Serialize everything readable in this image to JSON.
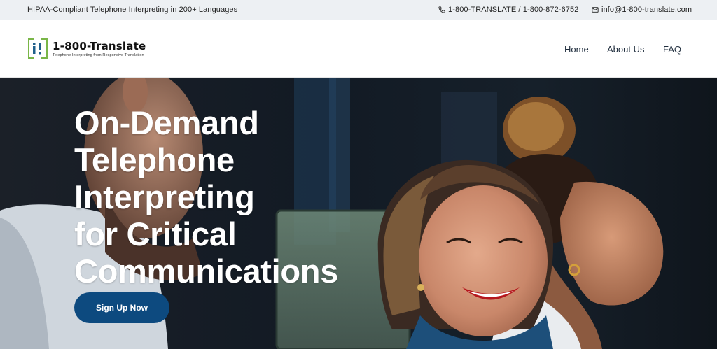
{
  "topbar": {
    "tagline": "HIPAA-Compliant Telephone Interpreting in 200+ Languages",
    "phone": "1-800-TRANSLATE / 1-800-872-6752",
    "email": "info@1-800-translate.com",
    "phone_icon": "phone-icon",
    "email_icon": "envelope-icon"
  },
  "header": {
    "logo_title": "1-800-Translate",
    "logo_subtitle": "Telephone Interpreting from Responsive Translation",
    "nav": [
      "Home",
      "About Us",
      "FAQ"
    ]
  },
  "hero": {
    "title_lines": [
      "On-Demand",
      "Telephone",
      "Interpreting",
      "for Critical",
      "Communications"
    ],
    "cta_label": "Sign Up Now"
  },
  "colors": {
    "topbar_bg": "#edf0f3",
    "cta_bg": "#0d4a7f",
    "logo_green": "#7ab648",
    "logo_blue": "#1f5f8b"
  }
}
